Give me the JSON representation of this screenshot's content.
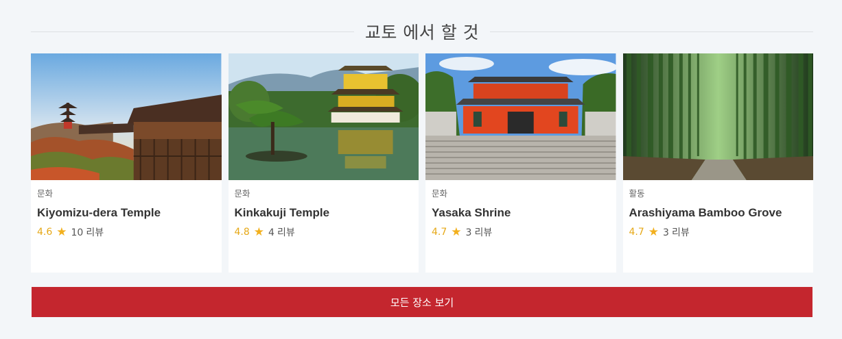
{
  "section": {
    "title": "교토 에서 할 것"
  },
  "cards": [
    {
      "category": "문화",
      "name": "Kiyomizu-dera Temple",
      "rating": "4.6",
      "review_count": "10",
      "review_label": "리뷰",
      "star_icon": "star-icon"
    },
    {
      "category": "문화",
      "name": "Kinkakuji Temple",
      "rating": "4.8",
      "review_count": "4",
      "review_label": "리뷰",
      "star_icon": "star-icon"
    },
    {
      "category": "문화",
      "name": "Yasaka Shrine",
      "rating": "4.7",
      "review_count": "3",
      "review_label": "리뷰",
      "star_icon": "star-icon"
    },
    {
      "category": "활동",
      "name": "Arashiyama Bamboo Grove",
      "rating": "4.7",
      "review_count": "3",
      "review_label": "리뷰",
      "star_icon": "star-icon"
    }
  ],
  "view_all": {
    "label": "모든 장소 보기"
  },
  "colors": {
    "accent_red": "#c4262e",
    "rating_gold": "#e6a817",
    "background": "#f3f6f9"
  }
}
